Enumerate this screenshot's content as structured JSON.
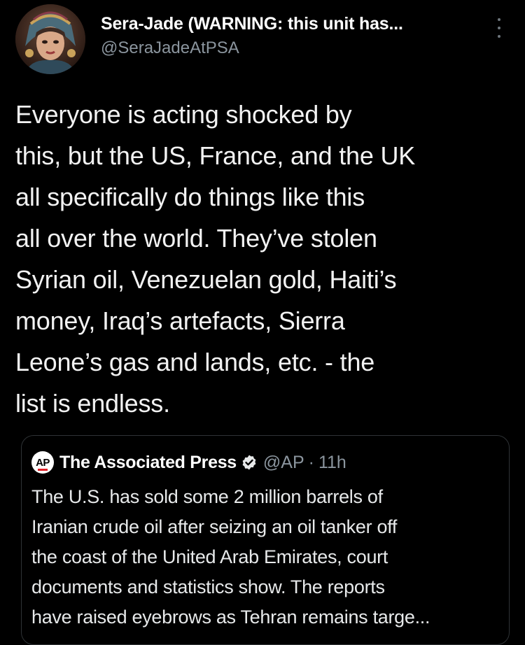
{
  "tweet": {
    "author": {
      "display_name": "Sera-Jade (WARNING: this unit has...",
      "handle": "@SeraJadeAtPSA",
      "avatar_icon": "avatar-portrait"
    },
    "more_icon": "more-vertical-icon",
    "text": "Everyone is acting shocked by\nthis, but the US, France, and the UK\nall specifically do things like this\nall over the world. They’ve stolen\nSyrian oil, Venezuelan gold, Haiti’s\nmoney, Iraq’s artefacts, Sierra\nLeone’s gas and lands, etc. - the\nlist is endless."
  },
  "quoted_tweet": {
    "logo_text": "AP",
    "author_name": "The Associated Press",
    "verified_icon": "verified-badge-icon",
    "handle": "@AP",
    "separator": "·",
    "time": "11h",
    "text": "The U.S. has sold some 2 million barrels of\nIranian crude oil after seizing an oil tanker off\nthe coast of the United Arab Emirates, court\ndocuments and statistics show. The reports\nhave raised eyebrows as Tehran remains targe..."
  },
  "colors": {
    "background": "#000000",
    "text": "#e7e9ea",
    "secondary_text": "#8b959e",
    "border": "#2f3336"
  }
}
